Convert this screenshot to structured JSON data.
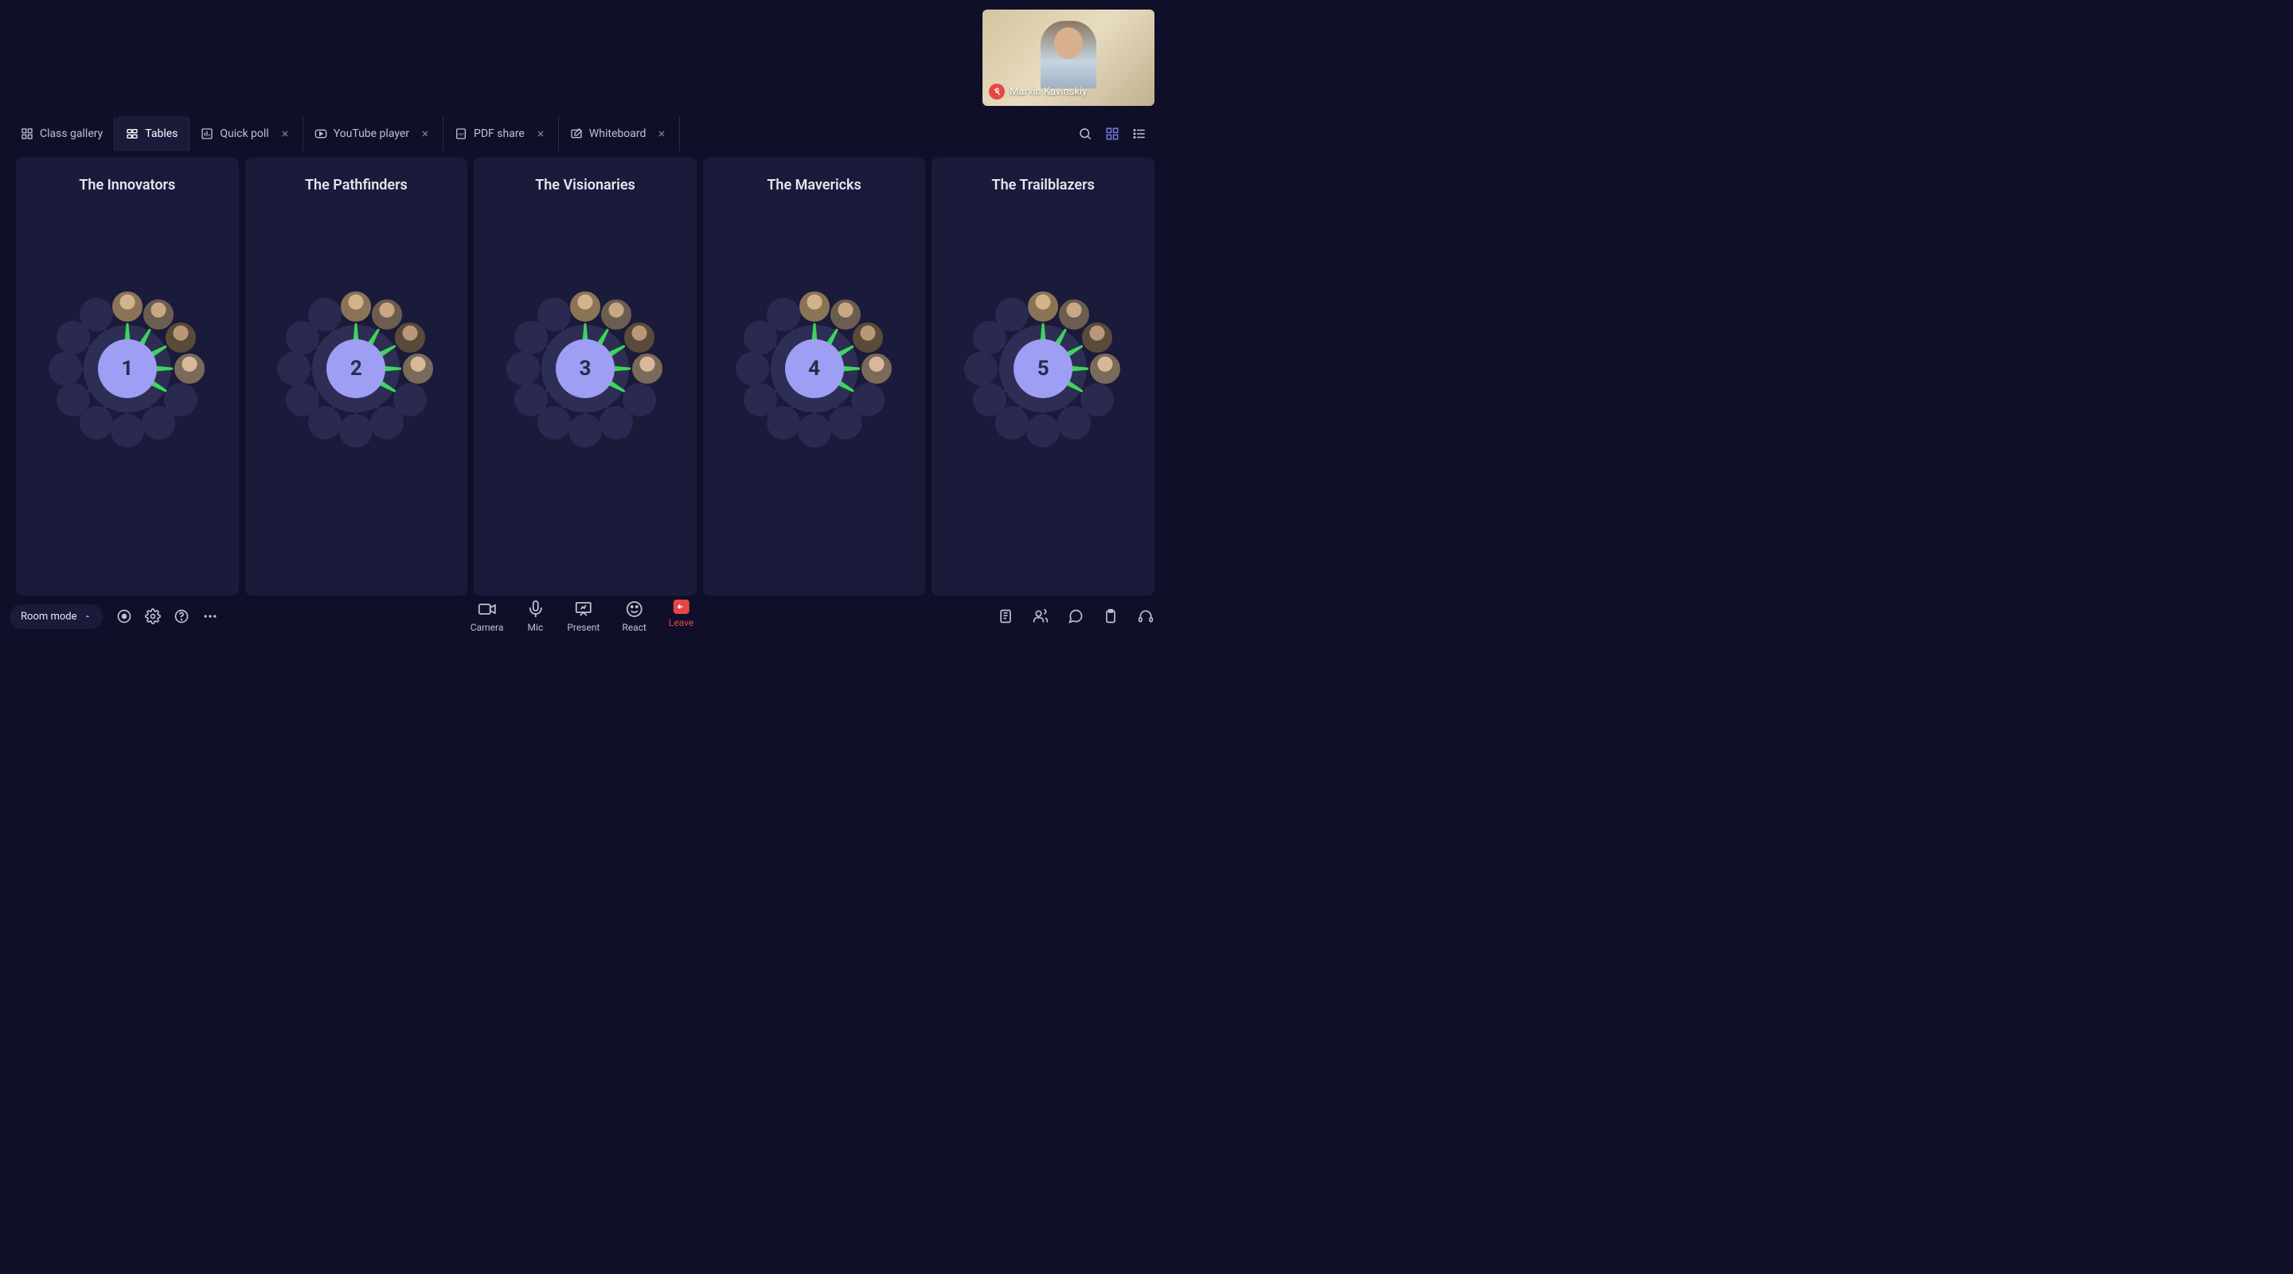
{
  "self_video": {
    "name": "Marvin Kavinskiy",
    "mic_muted": true
  },
  "tabs": [
    {
      "id": "class-gallery",
      "label": "Class gallery",
      "icon": "grid-icon",
      "closable": false,
      "active": false
    },
    {
      "id": "tables",
      "label": "Tables",
      "icon": "tables-icon",
      "closable": false,
      "active": true
    },
    {
      "id": "quick-poll",
      "label": "Quick poll",
      "icon": "poll-icon",
      "closable": true,
      "active": false
    },
    {
      "id": "youtube",
      "label": "YouTube player",
      "icon": "youtube-icon",
      "closable": true,
      "active": false
    },
    {
      "id": "pdf",
      "label": "PDF share",
      "icon": "pdf-icon",
      "closable": true,
      "active": false
    },
    {
      "id": "whiteboard",
      "label": "Whiteboard",
      "icon": "whiteboard-icon",
      "closable": true,
      "active": false
    }
  ],
  "tables": [
    {
      "title": "The Innovators",
      "number": "1",
      "filled_seats": [
        0,
        1,
        2,
        3
      ]
    },
    {
      "title": "The Pathfinders",
      "number": "2",
      "filled_seats": [
        0,
        1,
        2,
        3
      ]
    },
    {
      "title": "The Visionaries",
      "number": "3",
      "filled_seats": [
        0,
        1,
        2,
        3
      ]
    },
    {
      "title": "The Mavericks",
      "number": "4",
      "filled_seats": [
        0,
        1,
        2,
        3
      ]
    },
    {
      "title": "The Trailblazers",
      "number": "5",
      "filled_seats": [
        0,
        1,
        2,
        3
      ]
    }
  ],
  "seat_count": 12,
  "bottom": {
    "room_mode": "Room mode",
    "controls": {
      "camera": "Camera",
      "mic": "Mic",
      "present": "Present",
      "react": "React",
      "leave": "Leave"
    }
  },
  "colors": {
    "accent": "#9e9ef5",
    "petal": "#3dd65c",
    "danger": "#e84545"
  }
}
